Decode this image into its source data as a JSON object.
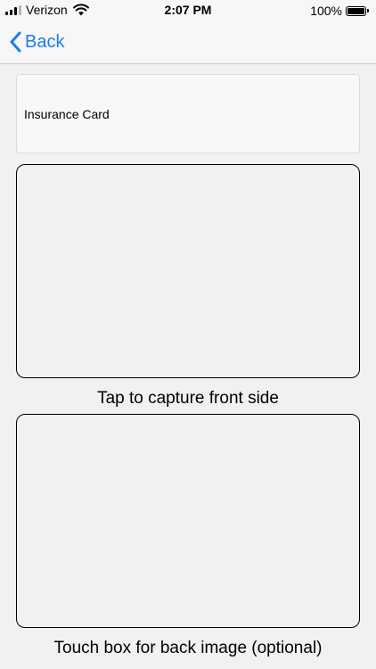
{
  "status_bar": {
    "carrier": "Verizon",
    "time": "2:07 PM",
    "battery_percent": "100%",
    "signal_bars": 3,
    "icons": [
      "signal-icon",
      "wifi-icon",
      "battery-icon"
    ]
  },
  "nav": {
    "back_label": "Back",
    "accent_color": "#1a7cf0"
  },
  "form": {
    "card_name": "Insurance Card",
    "front_caption": "Tap to capture front side",
    "back_caption": "Touch box for back image (optional)"
  }
}
